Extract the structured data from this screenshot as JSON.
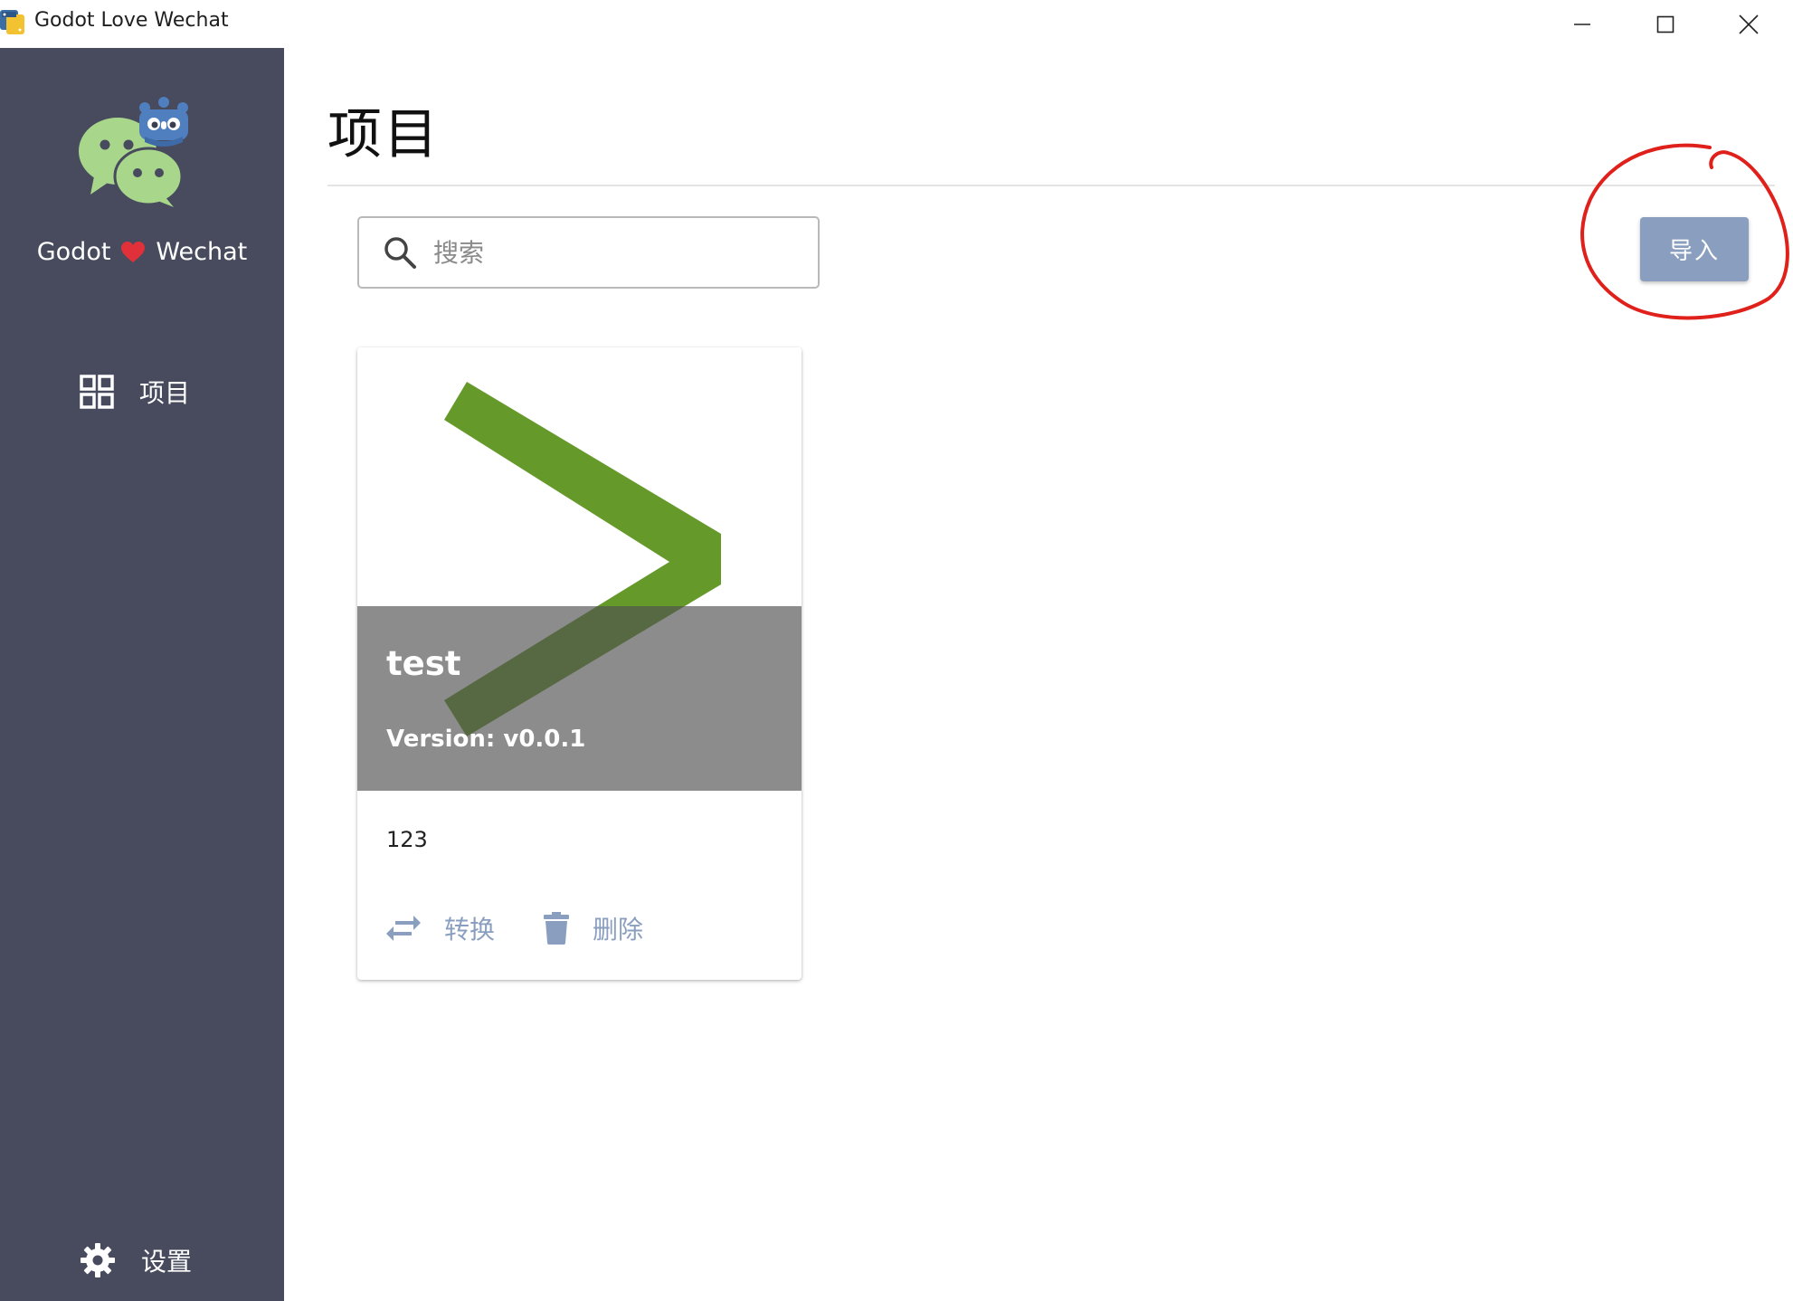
{
  "window": {
    "title": "Godot Love Wechat",
    "app_icon": "python-icon",
    "controls": [
      "minimize-icon",
      "maximize-icon",
      "close-icon"
    ]
  },
  "sidebar": {
    "brand_left": "Godot",
    "brand_right": "Wechat",
    "brand_icon": "heart-icon",
    "logo": "wechat-godot-logo",
    "items": [
      {
        "label": "项目",
        "icon": "grid-icon"
      },
      {
        "label": "设置",
        "icon": "gear-icon"
      }
    ],
    "background": "#474b5d"
  },
  "main": {
    "title": "项目",
    "search": {
      "placeholder": "搜索",
      "value": "",
      "icon": "search-icon"
    },
    "import_label": "导入",
    "accent": "#8a9fbf",
    "annotation_color": "#e0201a",
    "cards": [
      {
        "title": "test",
        "version": "Version: v0.0.1",
        "description": "123",
        "thumbnail": "green-chevron-icon",
        "actions": [
          {
            "label": "转换",
            "icon": "swap-arrows-icon"
          },
          {
            "label": "删除",
            "icon": "trash-icon"
          }
        ]
      }
    ]
  }
}
